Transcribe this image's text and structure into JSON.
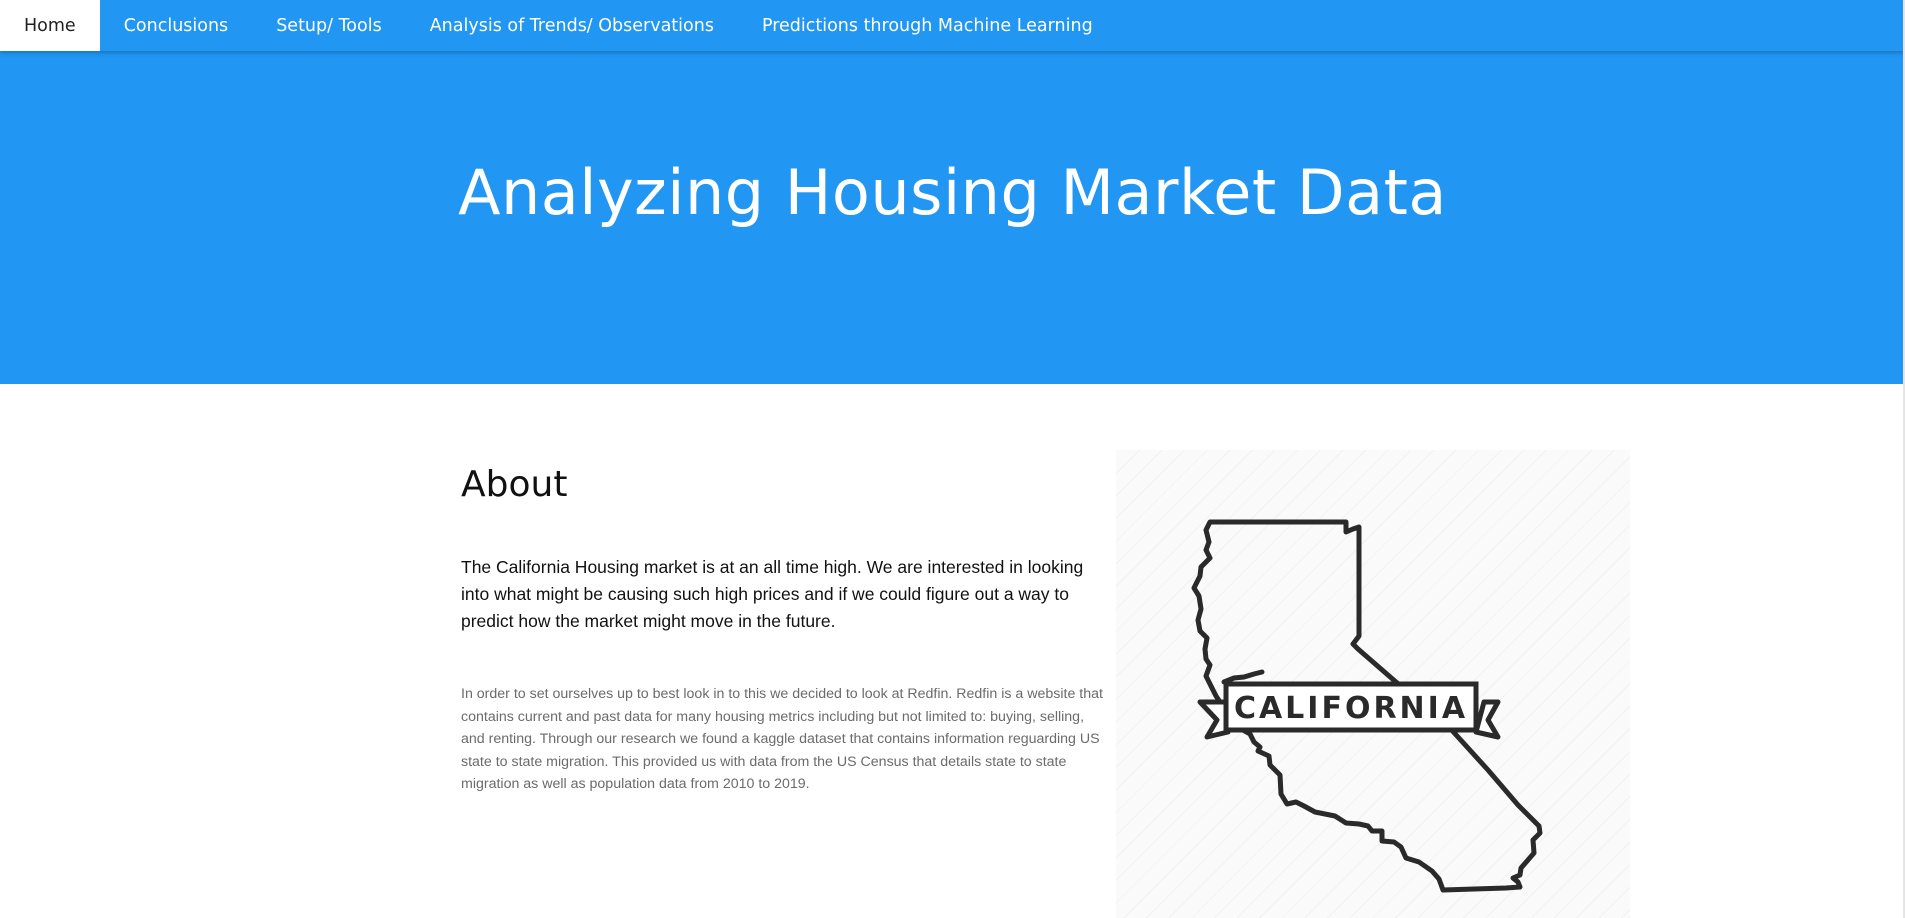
{
  "nav": {
    "items": [
      {
        "label": "Home",
        "active": true
      },
      {
        "label": "Conclusions",
        "active": false
      },
      {
        "label": "Setup/ Tools",
        "active": false
      },
      {
        "label": "Analysis of Trends/ Observations",
        "active": false
      },
      {
        "label": "Predictions through Machine Learning",
        "active": false
      }
    ]
  },
  "hero": {
    "title": "Analyzing Housing Market Data"
  },
  "about": {
    "heading": "About",
    "lead": "The California Housing market is at an all time high. We are interested in looking into what might be causing such high prices and if we could figure out a way to predict how the market might move in the future.",
    "detail": "In order to set ourselves up to best look in to this we decided to look at Redfin. Redfin is a website that contains current and past data for many housing metrics including but not limited to: buying, selling, and renting. Through our research we found a kaggle dataset that contains information reguarding US state to state migration. This provided us with data from the US Census that details state to state migration as well as population data from 2010 to 2019."
  },
  "illustration": {
    "banner_text": "CALIFORNIA",
    "outline_icon": "california-state-outline"
  },
  "colors": {
    "primary": "#2196f3",
    "nav_active_bg": "#ffffff",
    "text_dark": "#111111",
    "text_muted": "#6b6b6b",
    "outline": "#2a2a2a"
  }
}
